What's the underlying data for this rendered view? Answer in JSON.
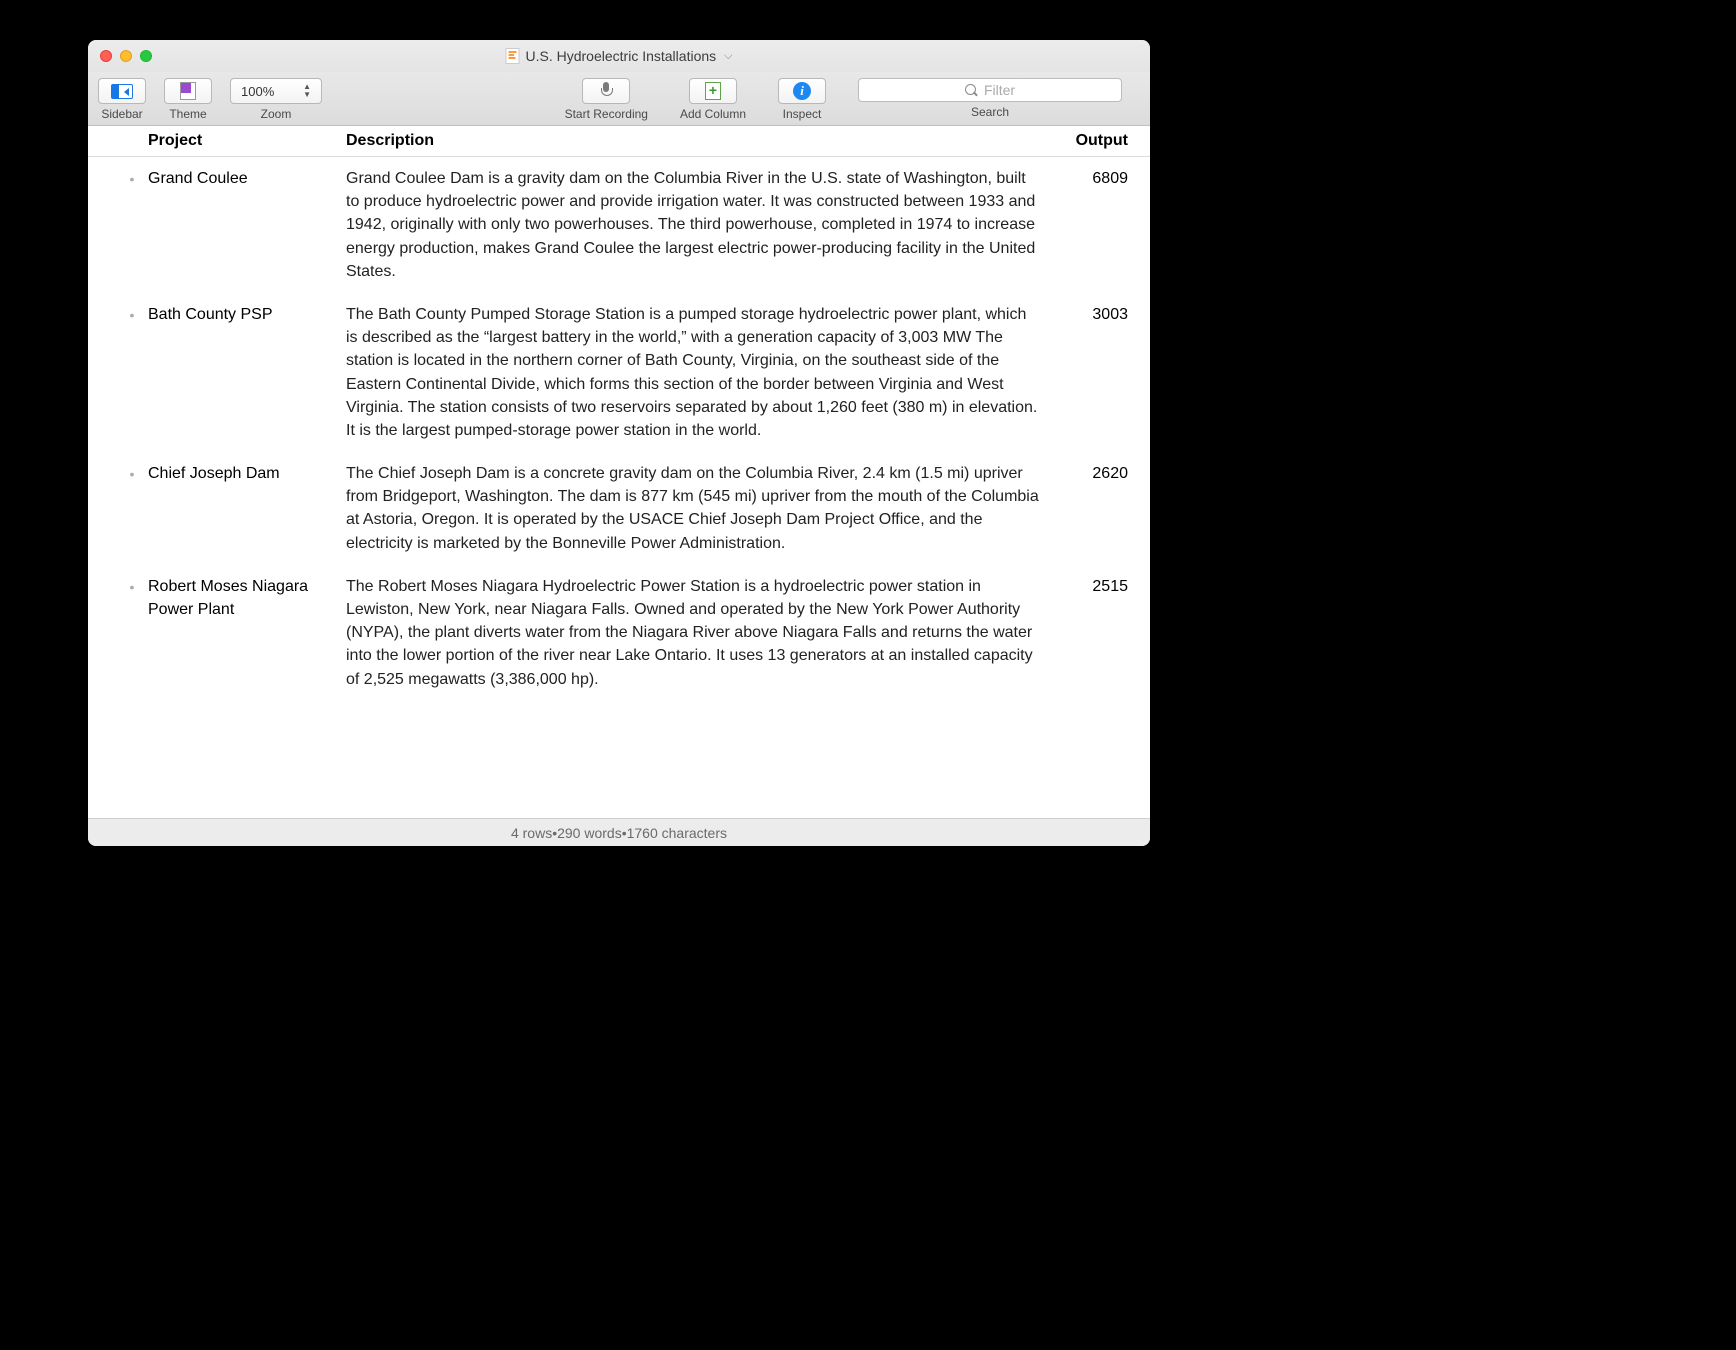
{
  "window": {
    "title": "U.S. Hydroelectric Installations"
  },
  "toolbar": {
    "sidebar_label": "Sidebar",
    "theme_label": "Theme",
    "zoom_label": "Zoom",
    "zoom_value": "100%",
    "start_recording_label": "Start Recording",
    "add_column_label": "Add Column",
    "inspect_label": "Inspect",
    "search_label": "Search",
    "filter_placeholder": "Filter"
  },
  "columns": {
    "project": "Project",
    "description": "Description",
    "output": "Output"
  },
  "rows": [
    {
      "project": "Grand Coulee",
      "description": "Grand Coulee Dam is a gravity dam on the Columbia River in the U.S. state of Washington, built to produce hydroelectric power and provide irrigation water. It was constructed between 1933 and 1942, originally with only two powerhouses. The third powerhouse, completed in 1974 to increase energy production, makes Grand Coulee the largest electric power-producing facility in the United States.",
      "output": "6809"
    },
    {
      "project": "Bath County PSP",
      "description": "The Bath County Pumped Storage Station is a pumped storage hydroelectric power plant, which is described as the “largest battery in the world,” with a generation capacity of 3,003 MW The station is located in the northern corner of Bath County, Virginia, on the southeast side of the Eastern Continental Divide, which forms this section of the border between Virginia and West Virginia. The station consists of two reservoirs separated by about 1,260 feet (380 m) in elevation. It is the largest pumped-storage power station in the world.",
      "output": "3003"
    },
    {
      "project": "Chief Joseph Dam",
      "description": "The Chief Joseph Dam is a concrete gravity dam on the Columbia River, 2.4 km (1.5 mi) upriver from Bridgeport, Washington. The dam is 877 km (545 mi) upriver from the mouth of the Columbia at Astoria, Oregon. It is operated by the USACE Chief Joseph Dam Project Office, and the electricity is marketed by the Bonneville Power Administration.",
      "output": "2620"
    },
    {
      "project": "Robert Moses Niagara Power Plant",
      "description": "The Robert Moses Niagara Hydroelectric Power Station is a hydroelectric power station in Lewiston, New York, near Niagara Falls. Owned and operated by the New York Power Authority (NYPA), the plant diverts water from the Niagara River above Niagara Falls and returns the water into the lower portion of the river near Lake Ontario. It uses 13 generators at an installed capacity of 2,525 megawatts (3,386,000 hp).",
      "output": "2515"
    }
  ],
  "status": {
    "rows_label": "4 rows",
    "words_label": "290 words",
    "chars_label": "1760 characters",
    "sep": " • "
  }
}
